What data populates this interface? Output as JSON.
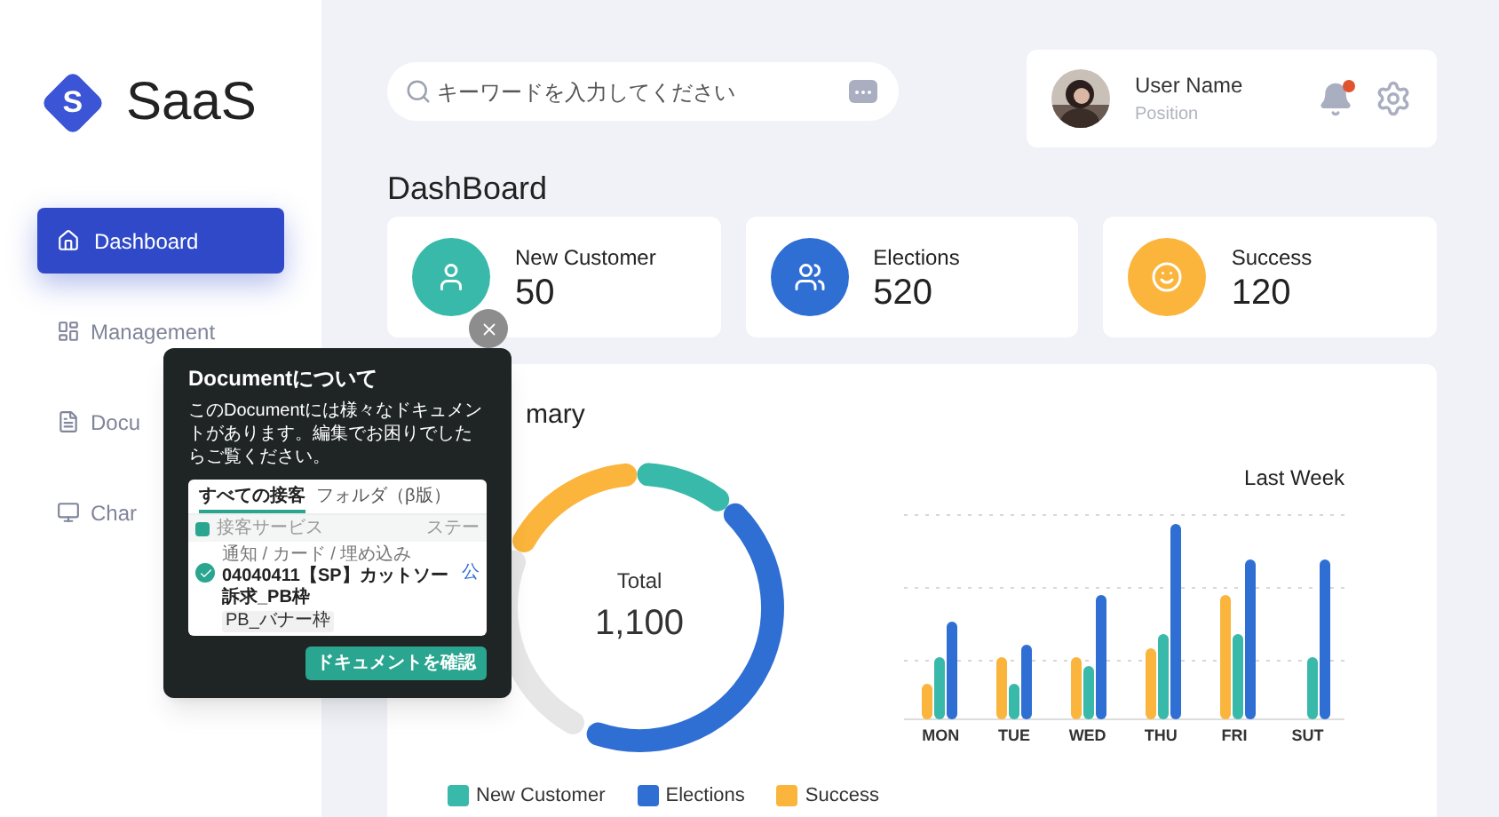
{
  "sidebar": {
    "logo": {
      "letter": "S",
      "name": "SaaS"
    },
    "items": [
      {
        "label": "Dashboard",
        "selected": true
      },
      {
        "label": "Management",
        "selected": false
      },
      {
        "label": "Docu",
        "selected": false
      },
      {
        "label": "Char",
        "selected": false
      }
    ]
  },
  "search": {
    "placeholder": "キーワードを入力してください"
  },
  "user": {
    "name": "User Name",
    "position": "Position",
    "notification": true
  },
  "page_title": "DashBoard",
  "stats": [
    {
      "label": "New Customer",
      "value": "50",
      "color": "#38b9a9"
    },
    {
      "label": "Elections",
      "value": "520",
      "color": "#2f6fd3"
    },
    {
      "label": "Success",
      "value": "120",
      "color": "#fbb53c"
    }
  ],
  "summary": {
    "title": "mary",
    "total_label": "Total",
    "total": "1,100",
    "chart_title": "Last Week",
    "days": [
      "MON",
      "TUE",
      "WED",
      "THU",
      "FRI",
      "SUT"
    ],
    "legend": [
      {
        "label": "New Customer",
        "color": "#38b9a9"
      },
      {
        "label": "Elections",
        "color": "#2f6fd3"
      },
      {
        "label": "Success",
        "color": "#fbb53c"
      }
    ]
  },
  "tooltip": {
    "title": "Documentについて",
    "body": "このDocumentには様々なドキュメントがあります。編集でお困りでしたらご覧ください。",
    "preview": {
      "tabs": [
        {
          "label": "すべての接客",
          "selected": true
        },
        {
          "label": "フォルダ（β版）",
          "selected": false
        }
      ],
      "header": "接客サービス",
      "header_cut": "ステー",
      "row_path": "通知 / カード / 埋め込み",
      "row_title": "04040411【SP】カットソー訴求_PB枠",
      "row_status": "公",
      "row_tag": "PB_バナー枠"
    },
    "button": "ドキュメントを確認"
  }
}
